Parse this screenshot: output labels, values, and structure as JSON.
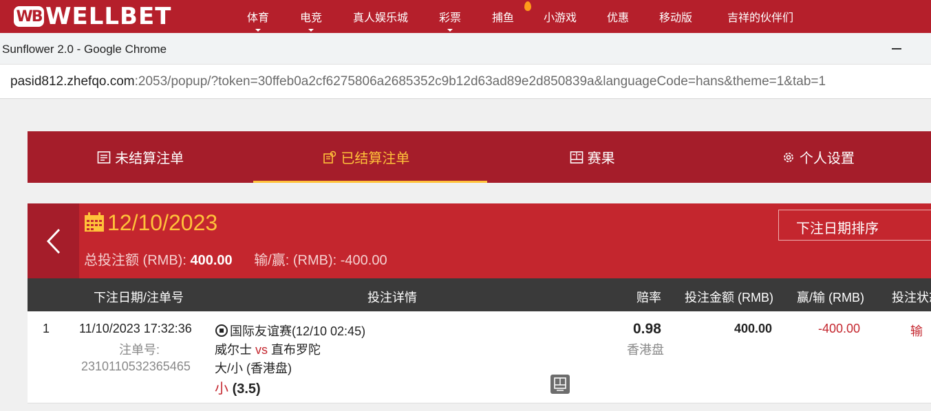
{
  "site": {
    "logo_mark": "WB",
    "logo_text": "WELLBET",
    "nav": [
      "体育",
      "电竞",
      "真人娱乐城",
      "彩票",
      "捕鱼",
      "小游戏",
      "优惠",
      "移动版",
      "吉祥的伙伴们"
    ]
  },
  "window": {
    "title": "Sunflower 2.0 - Google Chrome"
  },
  "url": {
    "host": "pasid812.zhefqo.com",
    "rest": ":2053/popup/?token=30ffeb0a2cf6275806a2685352c9b12d63ad89e2d850839a&languageCode=hans&theme=1&tab=1"
  },
  "tabs": [
    "未结算注单",
    "已结算注单",
    "赛果",
    "个人设置"
  ],
  "summary": {
    "date": "12/10/2023",
    "total_label": "总投注额 (RMB):",
    "total_value": "400.00",
    "winloss_label": "输/赢: (RMB):",
    "winloss_value": "-400.00",
    "sort_label": "下注日期排序"
  },
  "table": {
    "headers": [
      "下注日期/注单号",
      "投注详情",
      "赔率",
      "投注金额 (RMB)",
      "赢/输 (RMB)",
      "投注状态"
    ],
    "rows": [
      {
        "index": "1",
        "datetime": "11/10/2023 17:32:36",
        "ticket_label": "注单号:",
        "ticket_no": "2310110532365465",
        "league": "国际友谊赛(12/10 02:45)",
        "home": "威尔士",
        "vs": "vs",
        "away": "直布罗陀",
        "market": "大/小 (香港盘)",
        "selection": "小",
        "line": "(3.5)",
        "odds": "0.98",
        "odds_type": "香港盘",
        "stake": "400.00",
        "winloss": "-400.00",
        "status": "输"
      }
    ]
  },
  "colors": {
    "brand": "#b51f2b",
    "tab_bg": "#a51d2a",
    "header_bg": "#c4262e",
    "accent": "#ffc23a"
  }
}
